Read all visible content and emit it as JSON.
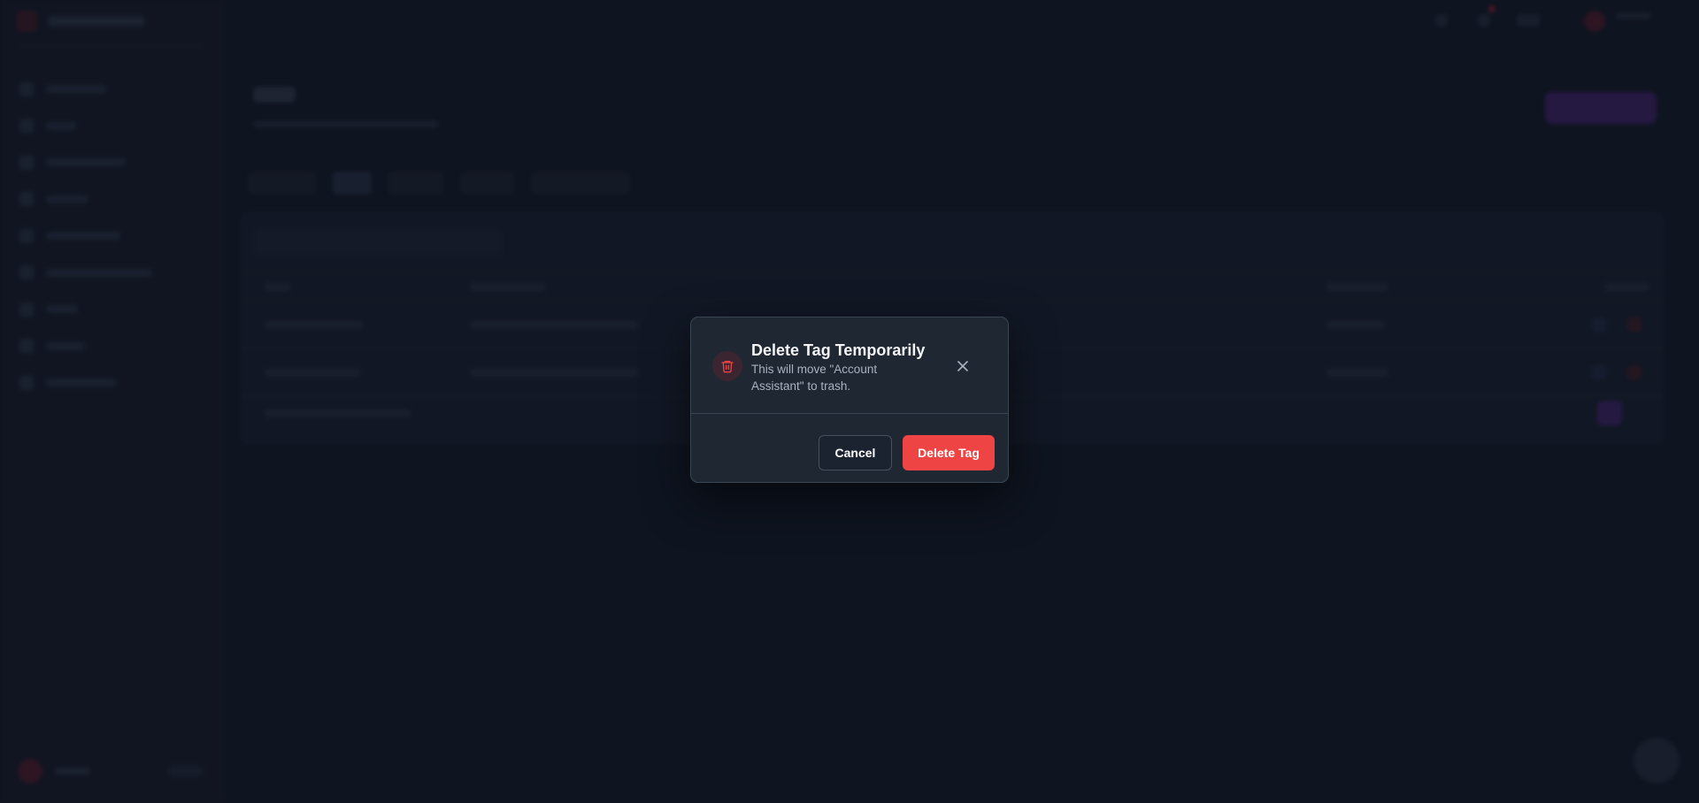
{
  "modal": {
    "title": "Delete Tag Temporarily",
    "message": "This will move \"Account Assistant\" to trash.",
    "cancel_label": "Cancel",
    "confirm_label": "Delete Tag",
    "icon": "trash-icon",
    "close_icon": "close-icon"
  },
  "colors": {
    "danger": "#ef4444",
    "modal_bg": "#1f2733",
    "page_bg": "#121a28"
  }
}
